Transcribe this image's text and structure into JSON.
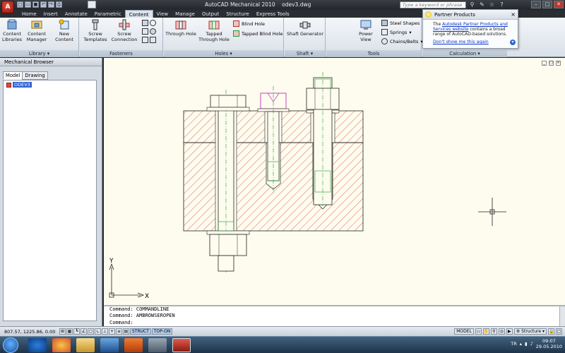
{
  "titlebar": {
    "app_title": "AutoCAD Mechanical 2010",
    "file_name": "odev3.dwg",
    "search_placeholder": "Type a keyword or phrase"
  },
  "tabs": [
    "Home",
    "Insert",
    "Annotate",
    "Parametric",
    "Content",
    "View",
    "Manage",
    "Output",
    "Structure",
    "Express Tools"
  ],
  "active_tab": "Content",
  "ribbon": {
    "library": {
      "title": "Library",
      "content_libraries": [
        "Content",
        "Libraries"
      ],
      "content_manager": [
        "Content",
        "Manager"
      ],
      "new_content": "New Content"
    },
    "fasteners": {
      "title": "Fasteners",
      "screw_templates": [
        "Screw",
        "Templates"
      ],
      "screw_connection": [
        "Screw",
        "Connection"
      ]
    },
    "holes": {
      "title": "Holes",
      "through_hole": "Through Hole",
      "tapped_through_hole": [
        "Tapped",
        "Through Hole"
      ],
      "blind_hole": "Blind Hole",
      "tapped_blind_hole": "Tapped Blind Hole"
    },
    "shaft": {
      "title": "Shaft",
      "shaft_generator": "Shaft Generator"
    },
    "tools": {
      "title": "Tools",
      "power_view": "Power View",
      "steel_shapes": "Steel Shapes",
      "springs": "Springs",
      "chains_belts": "Chains/Belts"
    },
    "calculation": {
      "title": "Calculation"
    }
  },
  "partner": {
    "title": "Partner Products",
    "body_prefix": "The",
    "link": "Autodesk Partner Products and Services website",
    "body_suffix": "contains a broad range of AutoCAD-based solutions.",
    "dont_show": "Don't show me this again"
  },
  "browser": {
    "title": "Mechanical Browser",
    "tabs": [
      "Model",
      "Drawing"
    ],
    "tree_root": "ODEV3"
  },
  "ucs": {
    "x_label": "X",
    "y_label": "Y"
  },
  "cmdline": {
    "line1": "Command: COMMANDLINE",
    "line2": "Command: AMBROWSEROPEN",
    "prompt": "Command:"
  },
  "statusbar": {
    "coords": "807.57, 1225.86, 0.00",
    "struct": "STRUCT",
    "topon": "TOP-ON",
    "model": "MODEL",
    "structure": "Structure"
  },
  "tray": {
    "lang": "TR",
    "time": "09:07",
    "date": "29.05.2010"
  },
  "colors": {
    "hatch": "#e23b3b",
    "thread": "#1b9c2c",
    "highlight": "#c030c0",
    "canvas": "#fdfcee"
  }
}
